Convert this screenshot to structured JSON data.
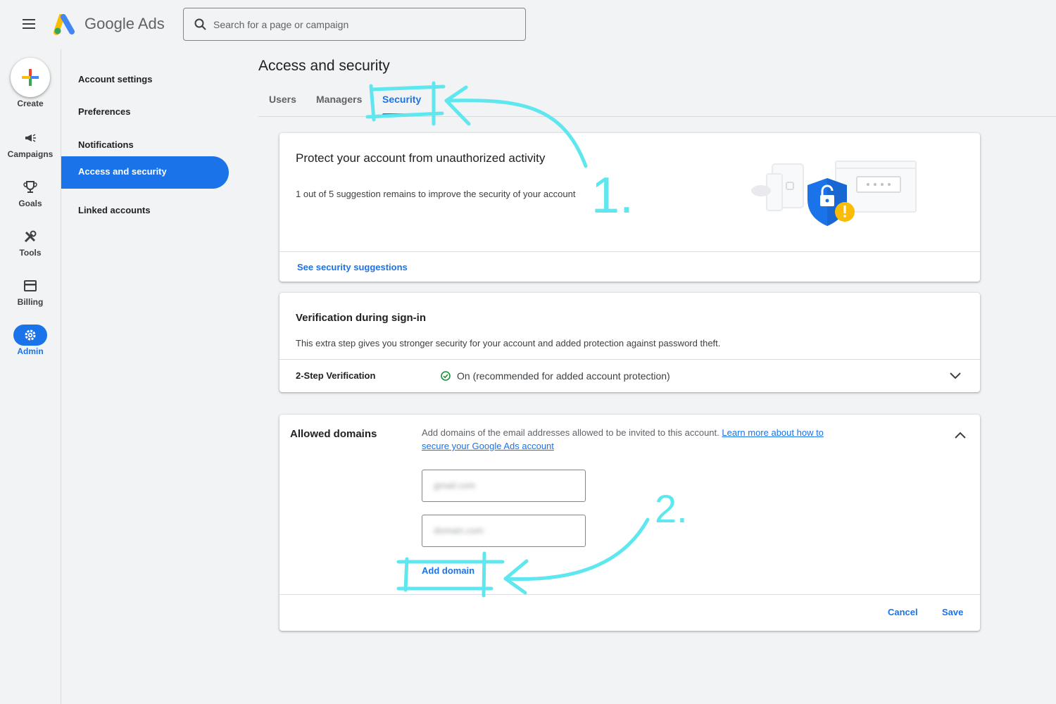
{
  "app": {
    "brand": "Google Ads"
  },
  "search": {
    "placeholder": "Search for a page or campaign"
  },
  "rail": {
    "create_label": "Create",
    "items": [
      {
        "label": "Campaigns",
        "icon": "megaphone-icon"
      },
      {
        "label": "Goals",
        "icon": "trophy-icon"
      },
      {
        "label": "Tools",
        "icon": "tools-icon"
      },
      {
        "label": "Billing",
        "icon": "credit-card-icon"
      },
      {
        "label": "Admin",
        "icon": "gear-icon",
        "active": true
      }
    ]
  },
  "subnav": {
    "items": [
      {
        "label": "Account settings"
      },
      {
        "label": "Preferences"
      },
      {
        "label": "Notifications"
      },
      {
        "label": "Access and security",
        "active": true
      },
      {
        "label": "Linked accounts"
      }
    ]
  },
  "page": {
    "title": "Access and security"
  },
  "tabs": [
    {
      "label": "Users"
    },
    {
      "label": "Managers"
    },
    {
      "label": "Security",
      "active": true
    }
  ],
  "protect_card": {
    "heading": "Protect your account from unauthorized activity",
    "body": "1 out of 5 suggestion remains to improve the security of your account",
    "link": "See security suggestions"
  },
  "verification_card": {
    "heading": "Verification during sign-in",
    "body": "This extra step gives you stronger security for your account and added protection against password theft.",
    "row_label": "2-Step Verification",
    "status": "On (recommended for added account protection)"
  },
  "domains_card": {
    "heading": "Allowed domains",
    "description": "Add domains of the email addresses allowed to be invited to this account.",
    "learn_more_line1": "Learn more about how to",
    "learn_more_line2": "secure your Google Ads account",
    "domain_values": [
      "gmail.com",
      "domain.com"
    ],
    "add_label": "Add domain",
    "cancel_label": "Cancel",
    "save_label": "Save"
  },
  "annotations": {
    "step1": "1.",
    "step2": "2."
  },
  "colors": {
    "accent": "#1a73e8",
    "annotation": "#5ee7ee",
    "success": "#1e8e3e",
    "warning": "#fbbc04"
  }
}
